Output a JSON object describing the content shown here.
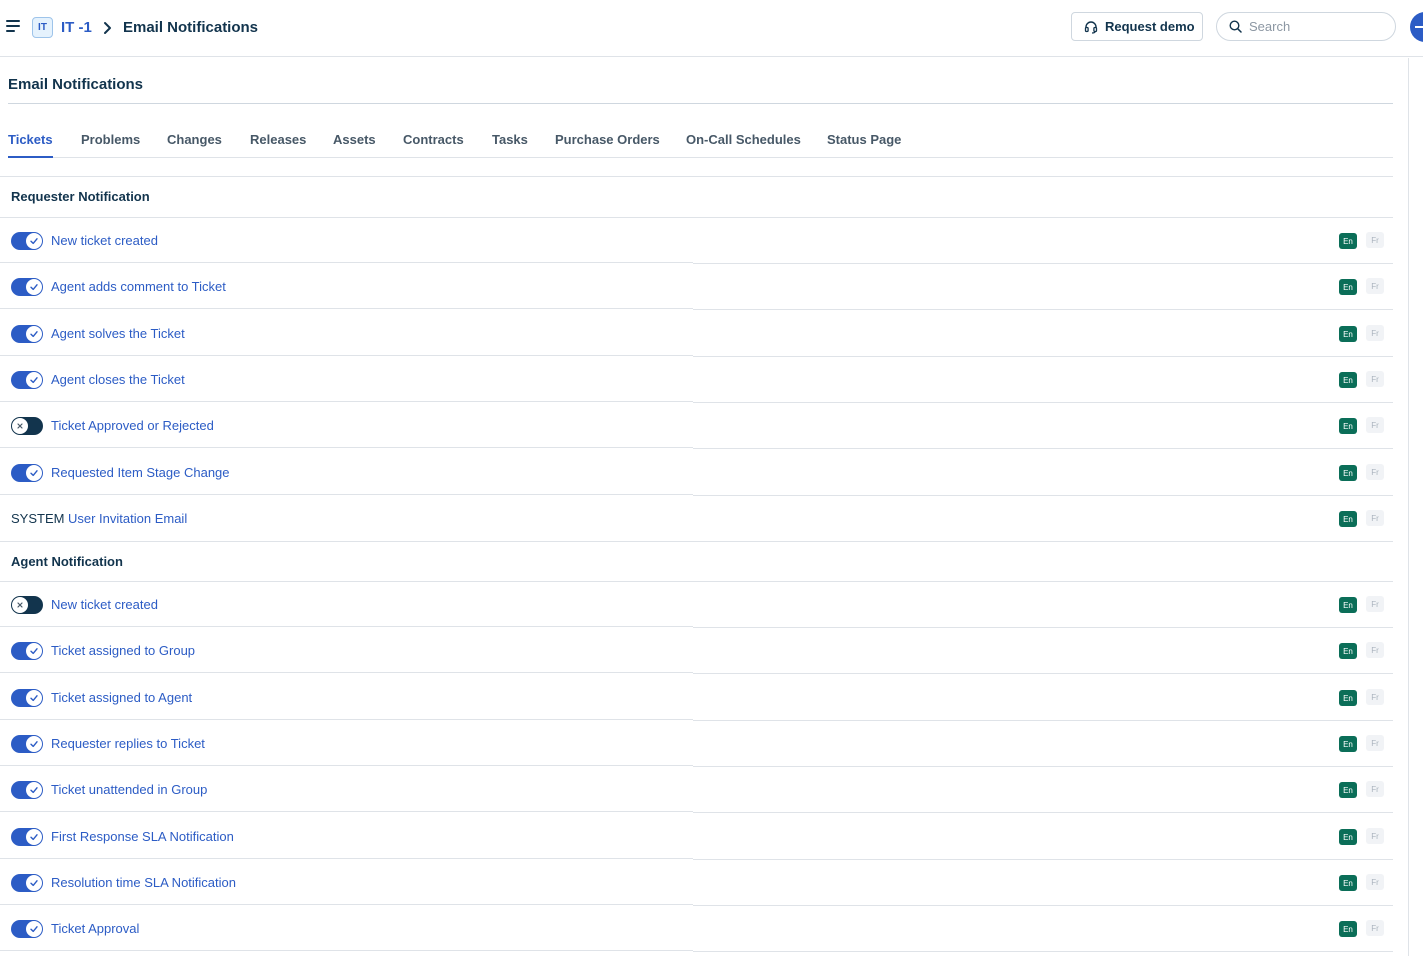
{
  "header": {
    "workspace_badge": "IT",
    "workspace_name": "IT -1",
    "breadcrumb_page": "Email Notifications",
    "request_demo_label": "Request demo",
    "search_placeholder": "Search"
  },
  "page": {
    "title": "Email Notifications"
  },
  "tabs": [
    {
      "label": "Tickets",
      "active": true
    },
    {
      "label": "Problems",
      "active": false
    },
    {
      "label": "Changes",
      "active": false
    },
    {
      "label": "Releases",
      "active": false
    },
    {
      "label": "Assets",
      "active": false
    },
    {
      "label": "Contracts",
      "active": false
    },
    {
      "label": "Tasks",
      "active": false
    },
    {
      "label": "Purchase Orders",
      "active": false
    },
    {
      "label": "On-Call Schedules",
      "active": false
    },
    {
      "label": "Status Page",
      "active": false
    }
  ],
  "requester_section": {
    "title": "Requester Notification",
    "rows": [
      {
        "label": "New ticket created",
        "enabled": true
      },
      {
        "label": "Agent adds comment to Ticket",
        "enabled": true
      },
      {
        "label": "Agent solves the Ticket",
        "enabled": true
      },
      {
        "label": "Agent closes the Ticket",
        "enabled": true
      },
      {
        "label": "Ticket Approved or Rejected",
        "enabled": false
      },
      {
        "label": "Requested Item Stage Change",
        "enabled": true
      }
    ],
    "system_row": {
      "tag": "SYSTEM",
      "label": "User Invitation Email"
    }
  },
  "agent_section": {
    "title": "Agent Notification",
    "rows": [
      {
        "label": "New ticket created",
        "enabled": false
      },
      {
        "label": "Ticket assigned to Group",
        "enabled": true
      },
      {
        "label": "Ticket assigned to Agent",
        "enabled": true
      },
      {
        "label": "Requester replies to Ticket",
        "enabled": true
      },
      {
        "label": "Ticket unattended in Group",
        "enabled": true
      },
      {
        "label": "First Response SLA Notification",
        "enabled": true
      },
      {
        "label": "Resolution time SLA Notification",
        "enabled": true
      },
      {
        "label": "Ticket Approval",
        "enabled": true
      }
    ]
  },
  "languages": {
    "en": "En",
    "fr": "Fr"
  },
  "colors": {
    "accent": "#2c5cc5",
    "toggle_off": "#12344d",
    "lang_active": "#0b6e58"
  },
  "icons": {
    "menu": "hamburger-menu-icon",
    "chevron": "chevron-right-icon",
    "headset": "headset-icon",
    "search": "search-icon",
    "check": "check-icon",
    "cross": "x-icon"
  }
}
